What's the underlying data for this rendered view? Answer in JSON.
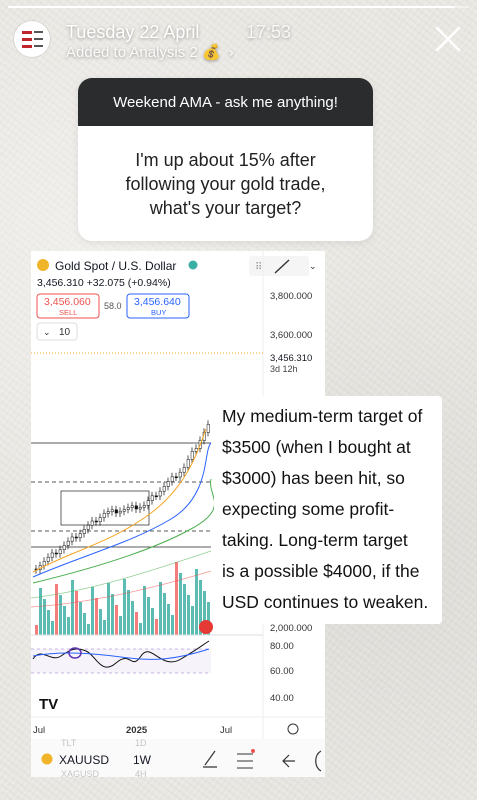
{
  "story": {
    "progress": 0.97,
    "date": "Tuesday 22 April",
    "time": "17:53",
    "added_to": "Added to Analysis 2",
    "added_emoji": "💰",
    "chevron": "›"
  },
  "question": {
    "header": "Weekend AMA - ask me anything!",
    "text": "I'm up about 15% after following your gold trade, what's your target?"
  },
  "chart": {
    "symbol_title": "Gold Spot / U.S. Dollar",
    "price_line": "3,456.310 +32.075 (+0.94%)",
    "sell_price": "3,456.060",
    "sell_label": "SELL",
    "spread": "58.0",
    "buy_price": "3,456.640",
    "buy_label": "BUY",
    "indicator_toggle": "10",
    "y_ticks": [
      "3,800.000",
      "3,600.000"
    ],
    "last_price": "3,456.310",
    "countdown": "3d 12h",
    "volume_tick": "2,000.000",
    "rsi_ticks": [
      "80.00",
      "60.00",
      "40.00"
    ],
    "x_labels": [
      "Jul",
      "2025",
      "Jul"
    ],
    "toolbar": {
      "ticker": "XAUUSD",
      "interval": "1W",
      "ghost_interval_top": "1D",
      "ghost_interval_bottom": "4H",
      "ghost_ticker": "XAGUSD"
    },
    "colors": {
      "up": "#26a69a",
      "down": "#ef5350",
      "ma_fast": "#f5a623",
      "ma_mid": "#2962ff",
      "ma_slow": "#4caf50"
    }
  },
  "answer": {
    "lines": [
      "My medium-term target of",
      "$3500 (when I bought at",
      "$3000) has been hit, so",
      "expecting some profit-",
      "taking. Long-term target",
      "is a possible $4000, if the",
      "USD continues to weaken."
    ]
  }
}
